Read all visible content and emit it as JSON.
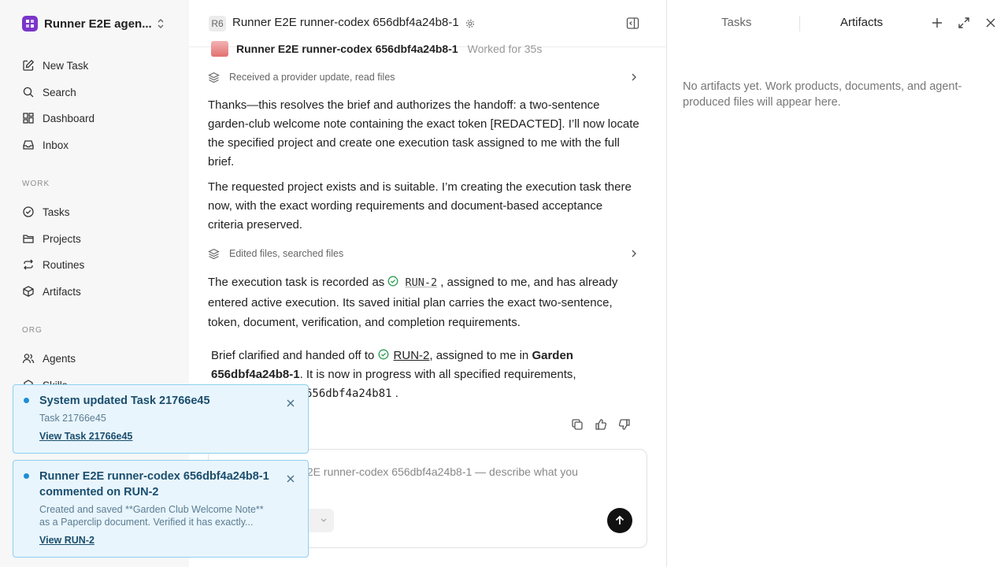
{
  "sidebar": {
    "workspace_name": "Runner E2E agen...",
    "items_top": [
      {
        "label": "New Task",
        "icon": "edit-icon"
      },
      {
        "label": "Search",
        "icon": "search-icon"
      },
      {
        "label": "Dashboard",
        "icon": "dashboard-icon"
      },
      {
        "label": "Inbox",
        "icon": "inbox-icon"
      }
    ],
    "section_work": "WORK",
    "items_work": [
      {
        "label": "Tasks",
        "icon": "check-circle-icon"
      },
      {
        "label": "Projects",
        "icon": "folder-icon"
      },
      {
        "label": "Routines",
        "icon": "repeat-icon"
      },
      {
        "label": "Artifacts",
        "icon": "cube-icon"
      }
    ],
    "section_org": "ORG",
    "items_org": [
      {
        "label": "Agents",
        "icon": "users-icon"
      },
      {
        "label": "Skills",
        "icon": "skills-icon"
      }
    ]
  },
  "header": {
    "badge": "R6",
    "title": "Runner E2E runner-codex 656dbf4a24b8-1"
  },
  "chat": {
    "agent_name": "Runner E2E runner-codex 656dbf4a24b8-1",
    "worked_for": "Worked for 35s",
    "activity_1": "Received a provider update, read files",
    "para_1": "Thanks—this resolves the brief and authorizes the handoff: a two-sentence garden-club welcome note containing the exact token [REDACTED]. I’ll now locate the specified project and create one execution task assigned to me with the full brief.",
    "para_2": "The requested project exists and is suitable. I’m creating the execution task there now, with the exact wording requirements and document-based acceptance criteria preserved.",
    "activity_2": "Edited files, searched files",
    "para_3_pre": "The execution task is recorded as ",
    "para_3_task": "RUN-2",
    "para_3_post": " , assigned to me, and has already entered active execution. Its saved initial plan carries the exact two-sentence, token, document, verification, and completion requirements.",
    "summary_pre": "Brief clarified and handed off to ",
    "summary_task": "RUN-2",
    "summary_mid": ", assigned to me in ",
    "summary_project": "Garden 656dbf4a24b8-1",
    "summary_post": ". It is now in progress with all specified requirements,",
    "summary_code": "656dbf4a24b81",
    "summary_end": " ."
  },
  "composer": {
    "placeholder_visible": "r E2E runner-codex 656dbf4a24b8-1 — describe what you"
  },
  "right_panel": {
    "tab_tasks": "Tasks",
    "tab_artifacts": "Artifacts",
    "empty_text": "No artifacts yet. Work products, documents, and agent-produced files will appear here."
  },
  "toasts": [
    {
      "title": "System updated Task 21766e45",
      "body": "Task 21766e45",
      "link": "View Task 21766e45"
    },
    {
      "title": "Runner E2E runner-codex 656dbf4a24b8-1 commented on RUN-2",
      "body": "Created and saved **Garden Club Welcome Note** as a Paperclip document. Verified it has exactly...",
      "link": "View RUN-2"
    }
  ],
  "colors": {
    "accent_purple": "#7a35c9",
    "toast_bg": "#e9f5fc",
    "toast_border": "#8ed0ef",
    "status_green": "#2e9e52"
  }
}
